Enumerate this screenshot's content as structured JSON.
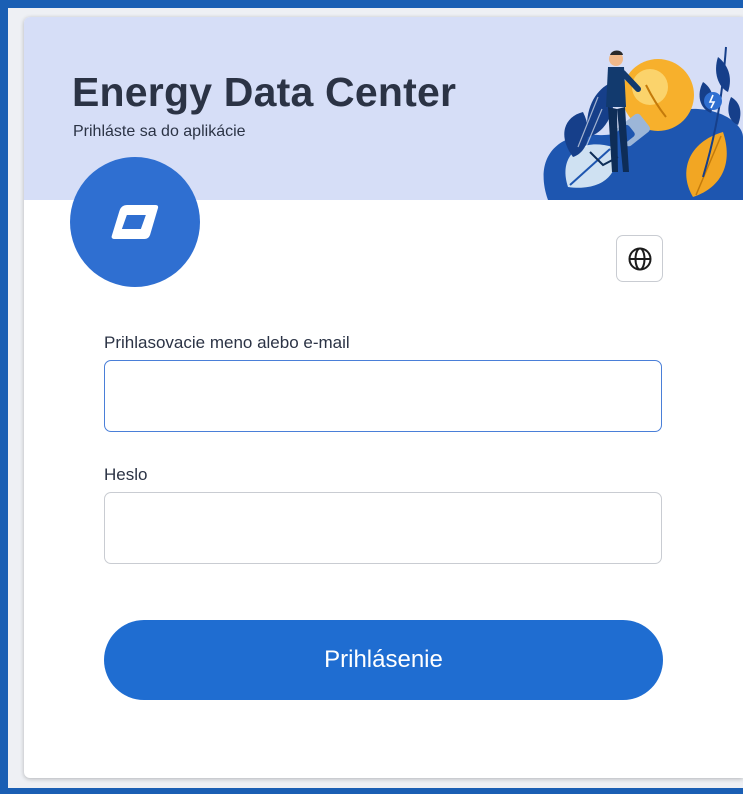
{
  "app": {
    "title": "Energy Data Center",
    "subtitle": "Prihláste sa do aplikácie"
  },
  "form": {
    "username_label": "Prihlasovacie meno alebo e-mail",
    "username_value": "",
    "password_label": "Heslo",
    "password_value": "",
    "submit_label": "Prihlásenie"
  },
  "icons": {
    "logo": "brand-logo-icon",
    "language": "globe-icon",
    "illustration": "lightbulb-illustration"
  },
  "colors": {
    "page_border": "#1a5fb4",
    "header_bg": "#d6def7",
    "logo_bg": "#2f6fd1",
    "button_bg": "#1f6dd1",
    "title_text": "#2b3345",
    "focus_border": "#4a7fd8"
  }
}
